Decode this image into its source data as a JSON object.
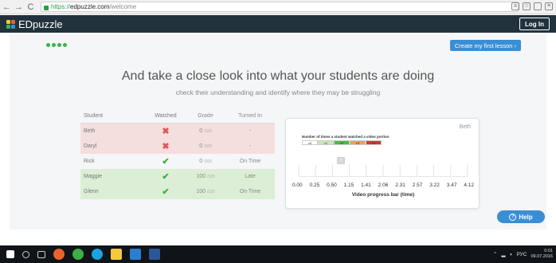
{
  "browser": {
    "url_scheme": "https://",
    "url_host": "edpuzzle.com",
    "url_path": "/welcome",
    "back_icon": "back-arrow-icon",
    "forward_icon": "forward-arrow-icon",
    "reload_icon": "reload-icon"
  },
  "header": {
    "brand": "EDpuzzle",
    "login_label": "Log In"
  },
  "main": {
    "create_label": "Create my first lesson ›",
    "headline": "And take a close look into what your students are doing",
    "subline": "check their understanding and identify where they may be struggling"
  },
  "table": {
    "columns": [
      "Student",
      "Watched",
      "Grade",
      "Turned In"
    ],
    "rows": [
      {
        "name": "Beth",
        "watched": false,
        "grade": "0",
        "den": "/100",
        "turned_in": "-"
      },
      {
        "name": "Daryl",
        "watched": false,
        "grade": "0",
        "den": "/100",
        "turned_in": "-"
      },
      {
        "name": "Rick",
        "watched": true,
        "grade": "0",
        "den": "/100",
        "turned_in": "On Time"
      },
      {
        "name": "Maggie",
        "watched": true,
        "grade": "100",
        "den": "/100",
        "turned_in": "Late"
      },
      {
        "name": "Glenn",
        "watched": true,
        "grade": "100",
        "den": "/100",
        "turned_in": "On Time"
      }
    ]
  },
  "chart_data": {
    "type": "bar",
    "student": "Beth",
    "legend_title": "Number of times a student watched a video portion",
    "legend": [
      {
        "label": "x0",
        "color": "#ffffff"
      },
      {
        "label": "x1",
        "color": "#c9e8b9"
      },
      {
        "label": "x2",
        "color": "#4fb848"
      },
      {
        "label": "x3",
        "color": "#f29d4b"
      },
      {
        "label": "x4",
        "color": "#e02d2d"
      }
    ],
    "x_ticks": [
      "0.00",
      "0.25",
      "0.50",
      "1.15",
      "1.41",
      "2.06",
      "2.31",
      "2.57",
      "3.22",
      "3.47",
      "4.12"
    ],
    "xlabel": "Video progress bar (time)",
    "marker_label": "?",
    "marker_position": 0.25,
    "values": [
      0,
      0,
      0,
      0,
      0,
      0,
      0,
      0,
      0,
      0
    ]
  },
  "help": {
    "label": "Help",
    "icon": "question-circle-icon"
  },
  "taskbar": {
    "tray_lang": "РУС",
    "clock_time": "0:01",
    "clock_date": "09.07.2016"
  },
  "colors": {
    "appbar": "#21323d",
    "accent": "#3a8ed4",
    "bad_row": "#f5dede",
    "good_row": "#dcefd6"
  }
}
